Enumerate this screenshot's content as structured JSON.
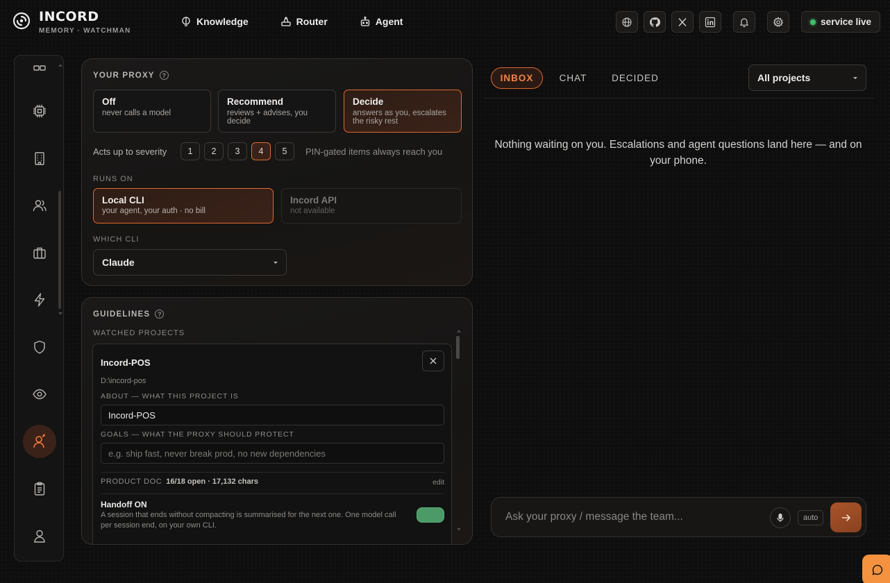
{
  "brand": {
    "name": "INCORD",
    "subtitle": "MEMORY · WATCHMAN"
  },
  "nav": [
    {
      "label": "Knowledge",
      "icon": "bulb-icon"
    },
    {
      "label": "Router",
      "icon": "router-icon"
    },
    {
      "label": "Agent",
      "icon": "robot-icon"
    }
  ],
  "topbar": {
    "icons": [
      "globe-icon",
      "github-icon",
      "x-icon",
      "linkedin-icon",
      "bell-icon",
      "gear-icon"
    ],
    "status": "service live",
    "status_color": "#3fbf6a"
  },
  "sidebar": {
    "items": [
      "grid-icon",
      "chip-icon",
      "building-icon",
      "users-icon",
      "briefcase-icon",
      "bolt-icon",
      "shield-icon",
      "eye-icon",
      "proxy-user-icon",
      "clipboard-icon",
      "user-icon"
    ],
    "active": "proxy-user-icon"
  },
  "proxy": {
    "title": "YOUR PROXY",
    "modes": [
      {
        "title": "Off",
        "desc": "never calls a model"
      },
      {
        "title": "Recommend",
        "desc": "reviews + advises, you decide"
      },
      {
        "title": "Decide",
        "desc": "answers as you, escalates the risky rest"
      }
    ],
    "selected_mode": "Decide",
    "severity_label": "Acts up to severity",
    "severity_options": [
      "1",
      "2",
      "3",
      "4",
      "5"
    ],
    "severity_selected": "4",
    "severity_note": "PIN-gated items always reach you",
    "runs_on_label": "RUNS ON",
    "runs_on": [
      {
        "title": "Local CLI",
        "desc": "your agent, your auth · no bill"
      },
      {
        "title": "Incord API",
        "desc": "not available"
      }
    ],
    "which_cli_label": "WHICH CLI",
    "which_cli_value": "Claude"
  },
  "guidelines": {
    "title": "GUIDELINES",
    "watched_label": "WATCHED PROJECTS",
    "project": {
      "name": "Incord-POS",
      "path": "D:\\incord-pos",
      "about_label": "ABOUT — WHAT THIS PROJECT IS",
      "about_value": "Incord-POS",
      "goals_label": "GOALS — WHAT THE PROXY SHOULD PROTECT",
      "goals_placeholder": "e.g. ship fast, never break prod, no new dependencies",
      "doc_label": "PRODUCT DOC",
      "doc_stats": "16/18 open · 17,132 chars",
      "doc_edit": "edit",
      "handoff_title": "Handoff ON",
      "handoff_desc": "A session that ends without compacting is summarised for the next one. One model call per session end, on your own CLI.",
      "handoff_on": true
    }
  },
  "inbox": {
    "tabs": [
      "INBOX",
      "CHAT",
      "DECIDED"
    ],
    "selected_tab": "INBOX",
    "project_filter": "All projects",
    "empty_message": "Nothing waiting on you. Escalations and agent questions land here — and on your phone.",
    "composer_placeholder": "Ask your proxy / message the team...",
    "auto_label": "auto"
  },
  "accent_color": "#e0692f"
}
